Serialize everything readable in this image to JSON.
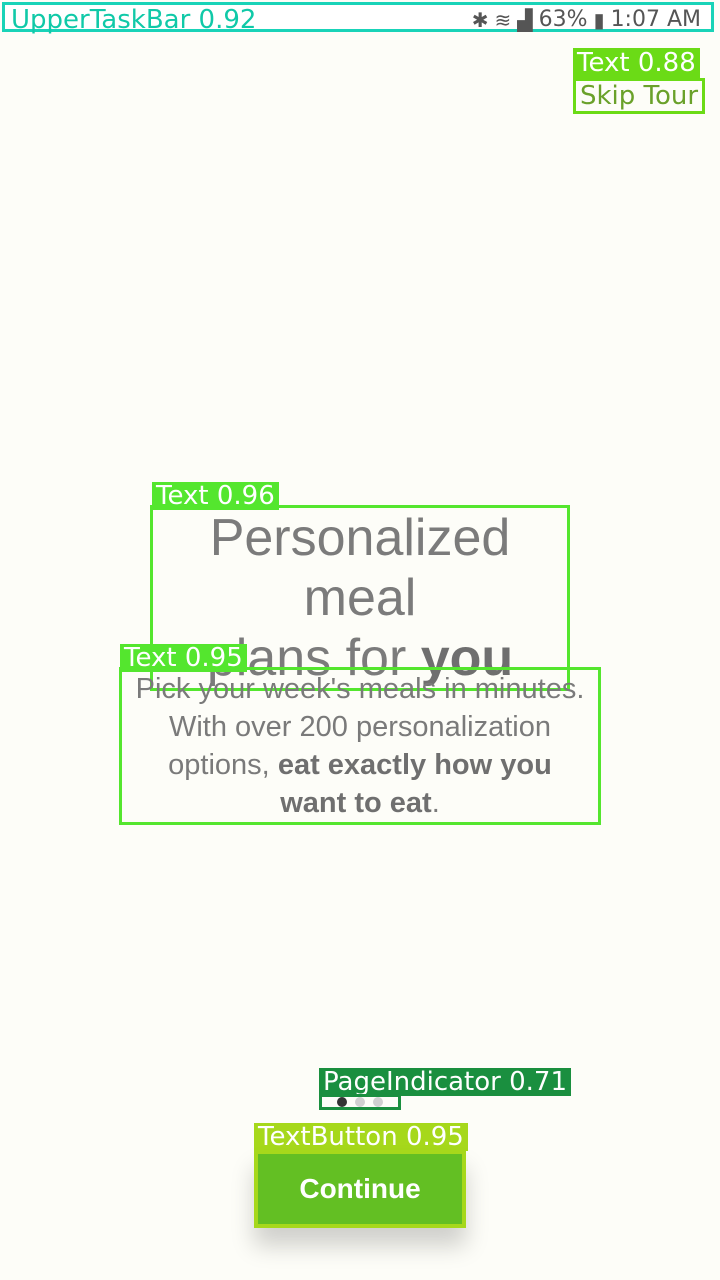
{
  "status_bar": {
    "label": "UpperTaskBar 0.92",
    "battery": "63%",
    "time": "1:07 AM",
    "icons": [
      "bluetooth-icon",
      "wifi-icon",
      "signal-icon",
      "battery-icon"
    ]
  },
  "skip_tour": {
    "tag": "Text 0.88",
    "label": "Skip Tour"
  },
  "title": {
    "tag": "Text 0.96",
    "line1": "Personalized meal",
    "line2_prefix": "plans for ",
    "line2_bold": "you"
  },
  "subtitle": {
    "tag": "Text 0.95",
    "line1": "Pick your week's meals in minutes.",
    "line2": "With over 200 personalization",
    "line3_prefix": "options, ",
    "line3_bold": "eat exactly how you",
    "line4_bold": "want to eat",
    "line4_suffix": "."
  },
  "page_indicator": {
    "tag": "PageIndicator 0.71",
    "active_index": 0,
    "count": 3
  },
  "continue_button": {
    "tag": "TextButton 0.95",
    "label": "Continue"
  },
  "colors": {
    "accent": "#63bf23",
    "detector_green": "#54e62e",
    "taskbar": "#19d3b8"
  }
}
